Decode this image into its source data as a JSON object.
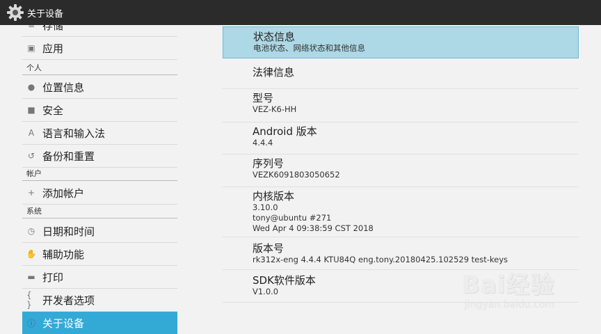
{
  "titlebar": {
    "title": "关于设备",
    "icon": "settings-gear-icon"
  },
  "left": {
    "items": [
      {
        "label": "存储",
        "icon": "storage-icon",
        "glyph": "≡"
      },
      {
        "label": "应用",
        "icon": "apps-icon",
        "glyph": "▣"
      },
      {
        "label": "位置信息",
        "icon": "location-pin-icon",
        "glyph": "●"
      },
      {
        "label": "安全",
        "icon": "lock-icon",
        "glyph": "■"
      },
      {
        "label": "语言和输入法",
        "icon": "keyboard-a-icon",
        "glyph": "A"
      },
      {
        "label": "备份和重置",
        "icon": "backup-restore-icon",
        "glyph": "↺"
      },
      {
        "label": "添加帐户",
        "icon": "plus-icon",
        "glyph": "+"
      },
      {
        "label": "日期和时间",
        "icon": "clock-icon",
        "glyph": "◷"
      },
      {
        "label": "辅助功能",
        "icon": "hand-icon",
        "glyph": "✋"
      },
      {
        "label": "打印",
        "icon": "printer-icon",
        "glyph": "▬"
      },
      {
        "label": "开发者选项",
        "icon": "code-braces-icon",
        "glyph": "{ }"
      },
      {
        "label": "关于设备",
        "icon": "info-icon",
        "glyph": "ⓘ"
      }
    ],
    "headers": [
      "个人",
      "帐户",
      "系统"
    ]
  },
  "right": {
    "items": [
      {
        "title": "状态信息",
        "sub": "电池状态、网络状态和其他信息"
      },
      {
        "title": "法律信息"
      },
      {
        "title": "型号",
        "sub": "VEZ-K6-HH"
      },
      {
        "title": "Android 版本",
        "sub": "4.4.4"
      },
      {
        "title": "序列号",
        "sub": "VEZK6091803050652"
      },
      {
        "title": "内核版本",
        "sub": [
          "3.10.0",
          "tony@ubuntu #271",
          "Wed Apr 4 09:38:59 CST 2018"
        ]
      },
      {
        "title": "版本号",
        "sub": "rk312x-eng 4.4.4 KTU84Q eng.tony.20180425.102529 test-keys"
      },
      {
        "title": "SDK软件版本",
        "sub": "V1.0.0"
      }
    ]
  },
  "watermark": {
    "brand": "Bai经验",
    "site": "jingyan.baidu.com"
  }
}
